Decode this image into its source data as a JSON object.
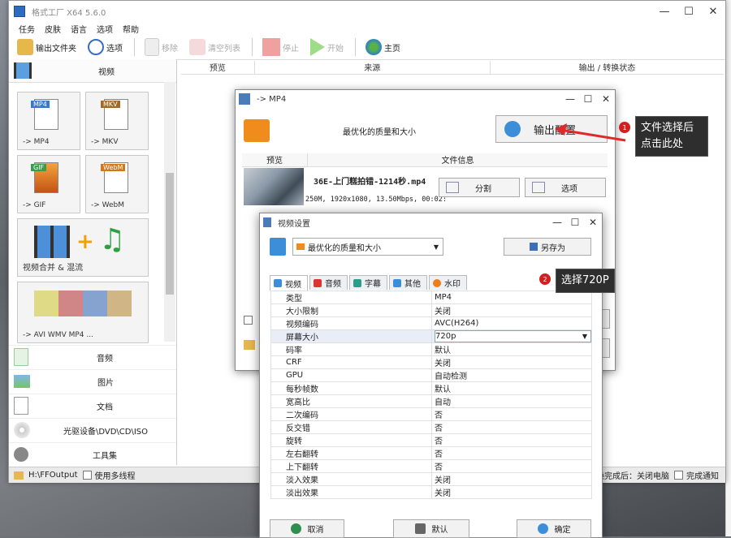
{
  "app": {
    "title": "格式工厂 X64 5.6.0",
    "min": "—",
    "max": "☐",
    "close": "✕"
  },
  "menu": [
    "任务",
    "皮肤",
    "语言",
    "选项",
    "帮助"
  ],
  "toolbar": [
    {
      "label": "输出文件夹",
      "icon": "folder-icon",
      "enabled": true
    },
    {
      "label": "选项",
      "icon": "options-icon",
      "enabled": true
    },
    {
      "label": "移除",
      "icon": "remove-icon",
      "enabled": false
    },
    {
      "label": "清空列表",
      "icon": "clear-list-icon",
      "enabled": false
    },
    {
      "label": "停止",
      "icon": "stop-icon",
      "enabled": false
    },
    {
      "label": "开始",
      "icon": "play-icon",
      "enabled": false
    },
    {
      "label": "主页",
      "icon": "home-icon",
      "enabled": true
    }
  ],
  "left": {
    "video_header": "视频",
    "tiles": [
      {
        "badge": "MP4",
        "label": "-> MP4"
      },
      {
        "badge": "MKV",
        "label": "-> MKV"
      },
      {
        "badge": "GIF",
        "label": "-> GIF"
      },
      {
        "badge": "WebM",
        "label": "-> WebM"
      },
      {
        "badge": "",
        "label": "视频合并 & 混流"
      },
      {
        "badge": "",
        "label": "-> AVI WMV MP4 ..."
      }
    ],
    "categories": [
      "音频",
      "图片",
      "文档",
      "光驱设备\\DVD\\CD\\ISO",
      "工具集"
    ]
  },
  "list_header": [
    "预览",
    "来源",
    "输出 / 转换状态"
  ],
  "statusbar": {
    "path": "H:\\FFOutput",
    "multithread": "使用多线程",
    "after": "转换完成后：关闭电脑",
    "notify": "完成通知"
  },
  "dialog1": {
    "title": "-> MP4",
    "quality": "最优化的质量和大小",
    "output_config": "输出配置",
    "col_preview": "预览",
    "col_info": "文件信息",
    "file_name": "36E-上门糕拍错-1214秒.mp4",
    "file_info": "250M, 1920x1080, 13.50Mbps, 00:02:",
    "split": "分割",
    "options": "选项"
  },
  "dialog2": {
    "title": "视频设置",
    "preset": "最优化的质量和大小",
    "save_as": "另存为",
    "tabs": [
      "视频",
      "音频",
      "字幕",
      "其他",
      "水印"
    ],
    "rows": [
      {
        "k": "类型",
        "v": "MP4"
      },
      {
        "k": "大小限制",
        "v": "关闭"
      },
      {
        "k": "视频编码",
        "v": "AVC(H264)"
      },
      {
        "k": "屏幕大小",
        "v": "720p"
      },
      {
        "k": "码率",
        "v": "默认"
      },
      {
        "k": "CRF",
        "v": "关闭"
      },
      {
        "k": "GPU",
        "v": "自动检测"
      },
      {
        "k": "每秒帧数",
        "v": "默认"
      },
      {
        "k": "宽高比",
        "v": "自动"
      },
      {
        "k": "二次编码",
        "v": "否"
      },
      {
        "k": "反交错",
        "v": "否"
      },
      {
        "k": "旋转",
        "v": "否"
      },
      {
        "k": "左右翻转",
        "v": "否"
      },
      {
        "k": "上下翻转",
        "v": "否"
      },
      {
        "k": "淡入效果",
        "v": "关闭"
      },
      {
        "k": "淡出效果",
        "v": "关闭"
      }
    ],
    "cancel": "取消",
    "default": "默认",
    "ok": "确定"
  },
  "annotations": {
    "callout1_num": "1",
    "callout1_text": "文件选择后点击此处",
    "callout2_num": "2",
    "callout2_text": "选择720P"
  },
  "colors": {
    "callout_bg": "#2e2e2e",
    "arrow_red": "#e0292a",
    "accent_blue": "#3d8ed8"
  }
}
